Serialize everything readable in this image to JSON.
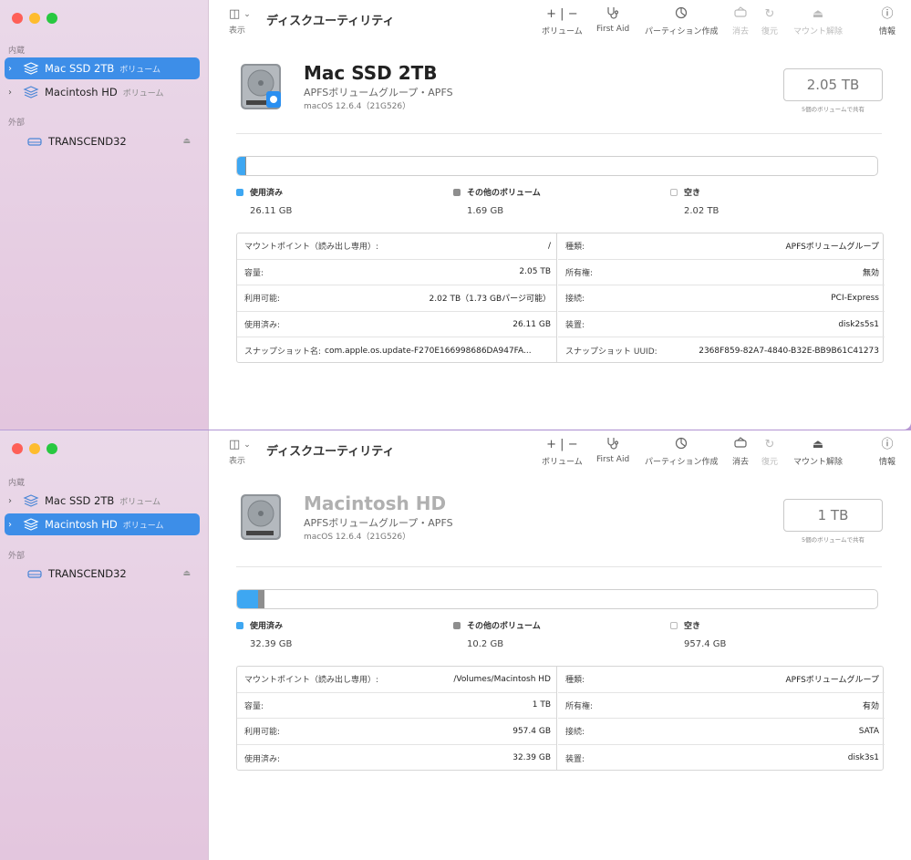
{
  "sidebar": {
    "internal_label": "内蔵",
    "external_label": "外部",
    "volume_tag": "ボリューム",
    "items": [
      {
        "name": "Mac SSD 2TB"
      },
      {
        "name": "Macintosh HD"
      }
    ],
    "external_items": [
      {
        "name": "TRANSCEND32",
        "eject": "⏏"
      }
    ]
  },
  "toolbar": {
    "view_label": "表示",
    "title": "ディスクユーティリティ",
    "buttons": {
      "volume": "ボリューム",
      "first_aid": "First Aid",
      "partition": "パーティション作成",
      "erase": "消去",
      "restore": "復元",
      "unmount": "マウント解除",
      "info": "情報"
    },
    "icons": {
      "sidebar": "sidebar-toggle-icon",
      "add": "+",
      "remove": "−",
      "stethoscope": "stethoscope-icon",
      "partition": "pie-icon",
      "erase": "eraser-icon",
      "restore": "restore-icon",
      "unmount": "unmount-icon",
      "info": "info-icon"
    }
  },
  "legend_labels": {
    "used": "使用済み",
    "other": "その他のボリューム",
    "free": "空き"
  },
  "colors": {
    "used": "#3ea7f2",
    "other": "#8e8e8e",
    "free": "#ffffff",
    "selection": "#3d8ee8"
  },
  "top": {
    "disk": {
      "name": "Mac SSD 2TB",
      "subtitle": "APFSボリュームグループ・APFS",
      "os": "macOS 12.6.4（21G526）",
      "capacity": "2.05 TB",
      "shared_note": "5個のボリュームで共有"
    },
    "usage": {
      "used_value": "26.11 GB",
      "other_value": "1.69 GB",
      "free_value": "2.02 TB",
      "used_fraction": 0.0127,
      "other_fraction": 0.0008
    },
    "info_left": [
      {
        "k": "マウントポイント（読み出し専用）:",
        "v": "/"
      },
      {
        "k": "容量:",
        "v": "2.05 TB"
      },
      {
        "k": "利用可能:",
        "v": "2.02 TB（1.73 GBパージ可能）"
      },
      {
        "k": "使用済み:",
        "v": "26.11 GB"
      },
      {
        "k": "スナップショット名:",
        "v": "com.apple.os.update-F270E166998686DA947FA..."
      }
    ],
    "info_right": [
      {
        "k": "種類:",
        "v": "APFSボリュームグループ"
      },
      {
        "k": "所有権:",
        "v": "無効"
      },
      {
        "k": "接続:",
        "v": "PCI-Express"
      },
      {
        "k": "装置:",
        "v": "disk2s5s1"
      },
      {
        "k": "スナップショット UUID:",
        "v": "2368F859-82A7-4840-B32E-BB9B61C41273"
      }
    ]
  },
  "bottom": {
    "disk": {
      "name": "Macintosh HD",
      "subtitle": "APFSボリュームグループ・APFS",
      "os": "macOS 12.6.4（21G526）",
      "capacity": "1 TB",
      "shared_note": "5個のボリュームで共有"
    },
    "usage": {
      "used_value": "32.39 GB",
      "other_value": "10.2 GB",
      "free_value": "957.4 GB",
      "used_fraction": 0.0324,
      "other_fraction": 0.0102
    },
    "info_left": [
      {
        "k": "マウントポイント（読み出し専用）:",
        "v": "/Volumes/Macintosh HD"
      },
      {
        "k": "容量:",
        "v": "1 TB"
      },
      {
        "k": "利用可能:",
        "v": "957.4 GB"
      },
      {
        "k": "使用済み:",
        "v": "32.39 GB"
      }
    ],
    "info_right": [
      {
        "k": "種類:",
        "v": "APFSボリュームグループ"
      },
      {
        "k": "所有権:",
        "v": "有効"
      },
      {
        "k": "接続:",
        "v": "SATA"
      },
      {
        "k": "装置:",
        "v": "disk3s1"
      }
    ]
  }
}
